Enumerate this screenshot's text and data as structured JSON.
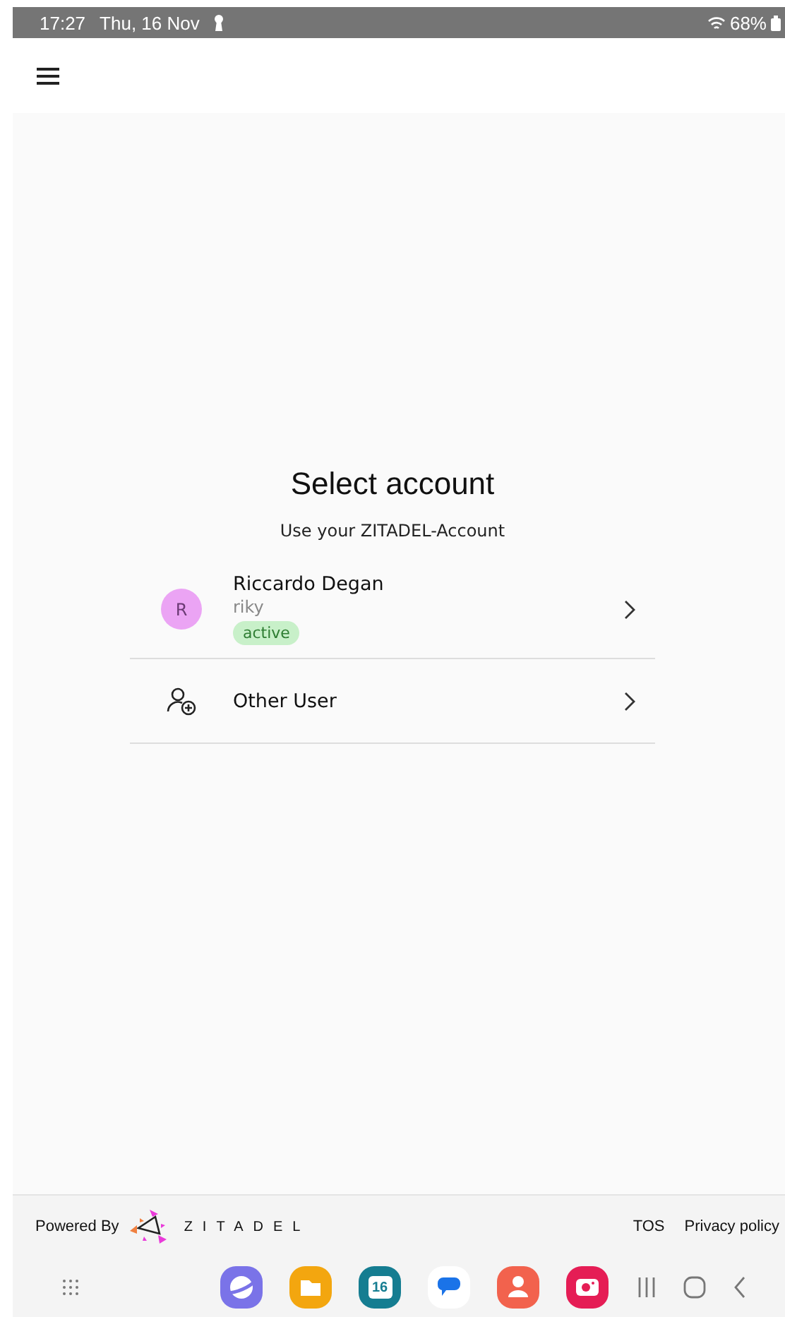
{
  "status_bar": {
    "time": "17:27",
    "date": "Thu, 16 Nov",
    "battery": "68%"
  },
  "login": {
    "title": "Select account",
    "subtitle": "Use your ZITADEL-Account",
    "accounts": [
      {
        "kind": "user",
        "initial": "R",
        "name": "Riccardo Degan",
        "login": "riky",
        "badge": "active",
        "color": "#eba4f4"
      },
      {
        "kind": "other",
        "name": "Other User"
      }
    ]
  },
  "footer": {
    "powered_by": "Powered By",
    "logo_text": "ZITADEL",
    "links": [
      "TOS",
      "Privacy policy"
    ]
  },
  "nav_bar": {
    "apps": [
      {
        "kind": "browser"
      },
      {
        "kind": "files"
      },
      {
        "kind": "calendar",
        "text": "16"
      },
      {
        "kind": "messages"
      },
      {
        "kind": "contacts"
      },
      {
        "kind": "camera"
      }
    ]
  }
}
